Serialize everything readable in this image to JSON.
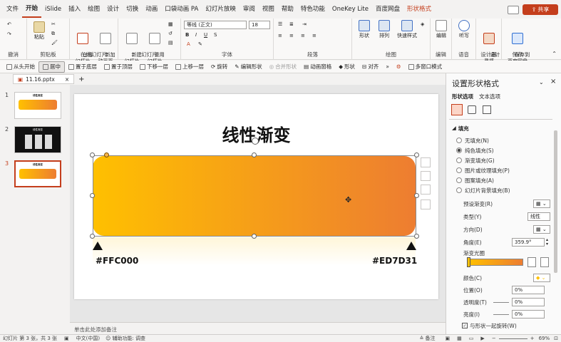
{
  "menubar": {
    "tabs": [
      "文件",
      "开始",
      "iSlide",
      "插入",
      "绘图",
      "设计",
      "切换",
      "动画",
      "口袋动画 PA",
      "幻灯片放映",
      "审阅",
      "视图",
      "帮助",
      "特色功能",
      "OneKey Lite",
      "百度网盘",
      "形状格式"
    ],
    "active_tab": "开始",
    "share_label": "共享"
  },
  "ribbon": {
    "groups": [
      "撤消",
      "剪贴板",
      "在线幻灯片",
      "幻灯片",
      "字体",
      "段落",
      "绘图",
      "编辑",
      "语音",
      "设计器",
      "保存"
    ],
    "paste_label": "粘贴",
    "online_slide": "在线\n幻灯片",
    "new_anim": "新加\n动画页",
    "new_slide": "新建\n幻灯片",
    "reuse_slide": "重用\n幻灯片",
    "font_name": "等线 (正文)",
    "font_size": "18",
    "shape_label": "形状",
    "arrange_label": "排列",
    "quick_style_label": "快速样式",
    "edit_label": "编辑",
    "listen_label": "听写",
    "design_label": "设计\n灵感",
    "save_baidu_label": "保存到\n百度网盘"
  },
  "toolbar2": [
    "从头开始",
    "居中",
    "置于底层",
    "置于顶层",
    "下移一层",
    "上移一层",
    "旋转",
    "编辑形状",
    "合并形状",
    "动画窗格",
    "形状",
    "对齐"
  ],
  "toolbar2_selected": "居中",
  "multi_window": "多窗口模式",
  "file_tab": "11.16.pptx",
  "slides": [
    {
      "number": "1",
      "caption": "线性渐变"
    },
    {
      "number": "2",
      "caption": "线性渐变"
    },
    {
      "number": "3",
      "caption": "线性渐变"
    }
  ],
  "selected_slide": "3",
  "slide": {
    "title": "线性渐变",
    "left_color_label": "#FFC000",
    "right_color_label": "#ED7D31",
    "gradient_start": "#FFC000",
    "gradient_end": "#ED7D31"
  },
  "notes_placeholder": "单击此处添加备注",
  "pane": {
    "title": "设置形状格式",
    "tab_shape": "形状选项",
    "tab_text": "文本选项",
    "section_fill": "填充",
    "fill_options": [
      "无填充(N)",
      "纯色填充(S)",
      "渐变填充(G)",
      "图片或纹理填充(P)",
      "图案填充(A)",
      "幻灯片背景填充(B)"
    ],
    "selected_fill": "纯色填充(S)",
    "preset_label": "预设渐变(R)",
    "type_label": "类型(Y)",
    "type_value": "线性",
    "direction_label": "方向(D)",
    "angle_label": "角度(E)",
    "angle_value": "359.9°",
    "stops_label": "渐变光圈",
    "color_label": "颜色(C)",
    "position_label": "位置(O)",
    "position_value": "0%",
    "transparency_label": "透明度(T)",
    "transparency_value": "0%",
    "brightness_label": "亮度(I)",
    "brightness_value": "0%",
    "rotate_with_shape": "与形状一起旋转(W)"
  },
  "status": {
    "slide_info": "幻灯片 第 3 张，共 3 张",
    "language": "中文(中国)",
    "accessibility": "辅助功能: 调查",
    "notes_btn": "备注",
    "zoom": "69%"
  }
}
